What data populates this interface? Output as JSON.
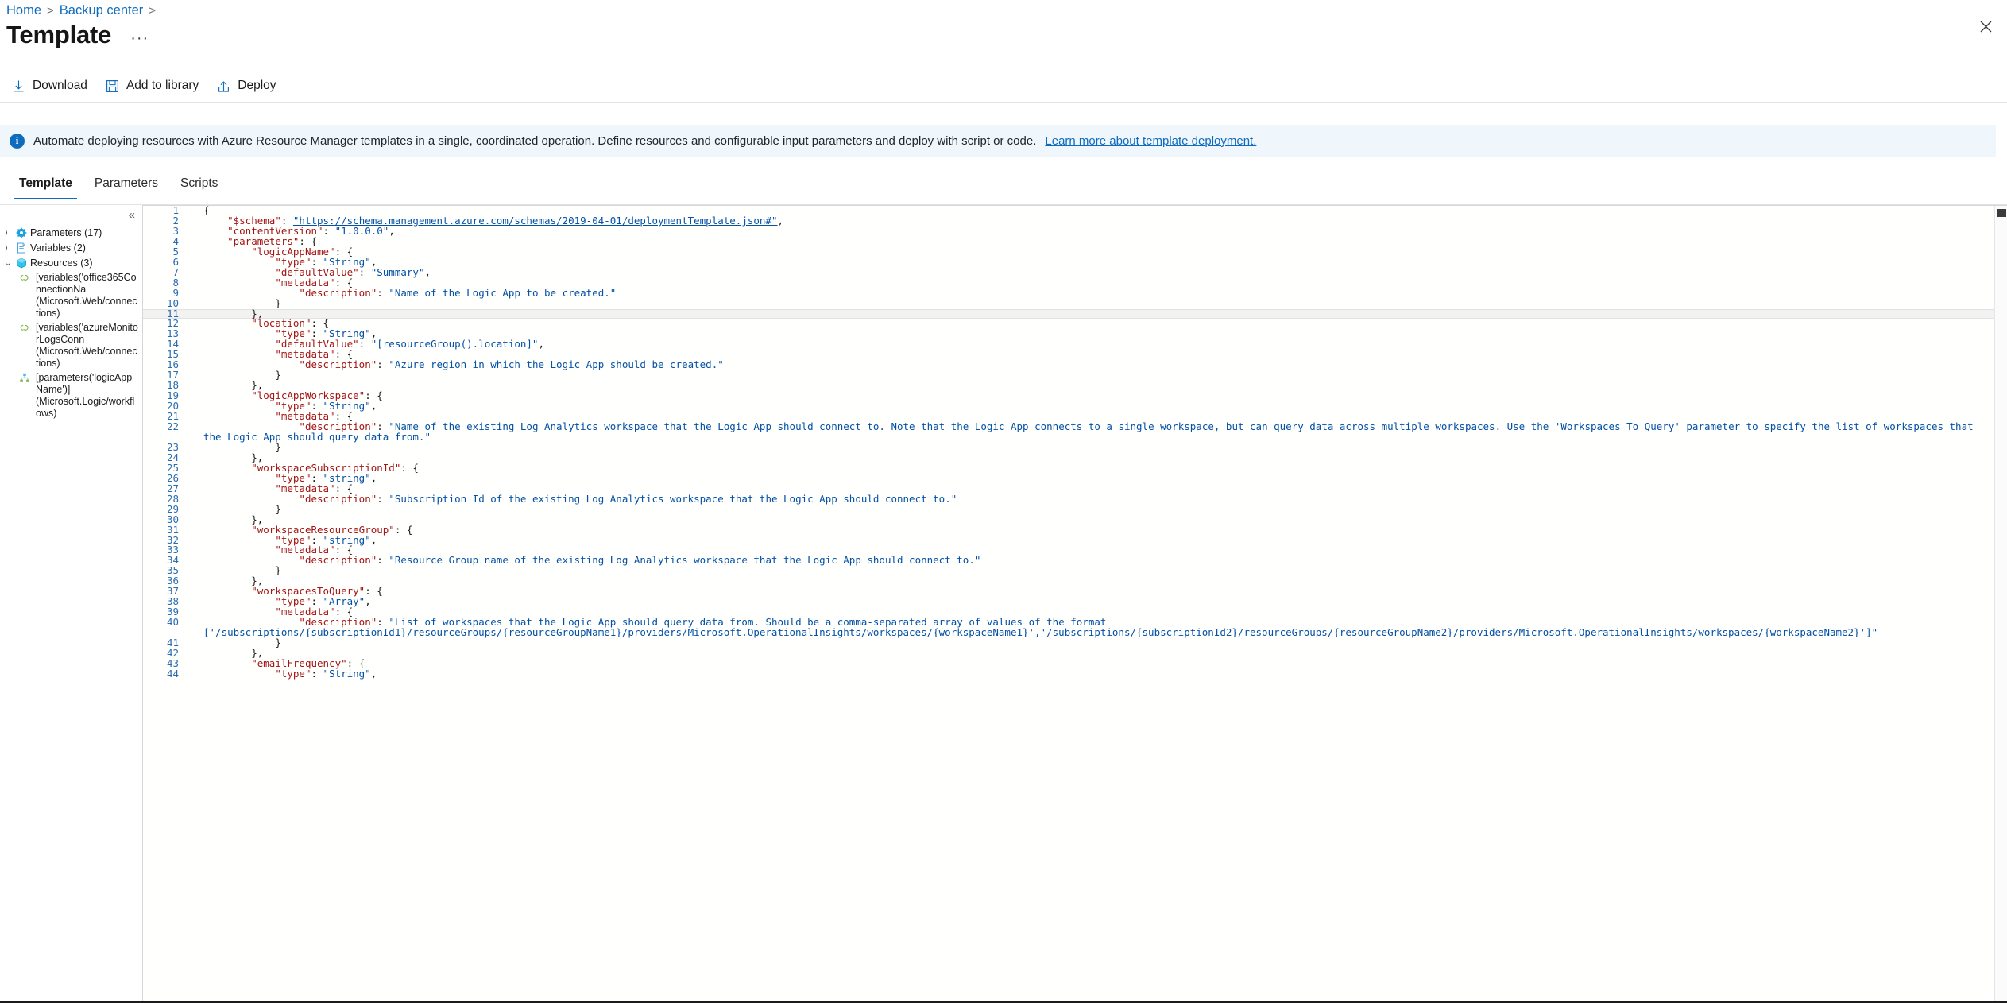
{
  "breadcrumb": {
    "items": [
      "Home",
      "Backup center"
    ],
    "separator": ">"
  },
  "header": {
    "title": "Template",
    "more_label": "···",
    "close_icon": "close-icon"
  },
  "commandbar": {
    "items": [
      {
        "label": "Download",
        "icon": "download-icon"
      },
      {
        "label": "Add to library",
        "icon": "save-floppy-icon"
      },
      {
        "label": "Deploy",
        "icon": "upload-icon"
      }
    ]
  },
  "banner": {
    "icon": "info-icon",
    "text": "Automate deploying resources with Azure Resource Manager templates in a single, coordinated operation. Define resources and configurable input parameters and deploy with script or code. ",
    "link": "Learn more about template deployment.",
    "background": "#eff6fc",
    "accent": "#0f6cbd"
  },
  "tabs": {
    "items": [
      {
        "label": "Template",
        "active": true
      },
      {
        "label": "Parameters",
        "active": false
      },
      {
        "label": "Scripts",
        "active": false
      }
    ]
  },
  "tree": {
    "collapse_icon": "chevron-double-left-icon",
    "nodes": [
      {
        "chevron": "›",
        "icon": "parameters-gear-icon",
        "label": "Parameters (17)",
        "expanded": false
      },
      {
        "chevron": "›",
        "icon": "variables-doc-icon",
        "label": "Variables (2)",
        "expanded": false
      },
      {
        "chevron": "⌄",
        "icon": "resources-cube-icon",
        "label": "Resources (3)",
        "expanded": true
      }
    ],
    "resources": [
      {
        "icon": "connection-link-icon",
        "name": "[variables('office365ConnectionNa",
        "type": "(Microsoft.Web/connections)"
      },
      {
        "icon": "connection-link-icon",
        "name": "[variables('azureMonitorLogsConn",
        "type": "(Microsoft.Web/connections)"
      },
      {
        "icon": "logic-app-icon",
        "name": "[parameters('logicAppName')]",
        "type": "(Microsoft.Logic/workflows)"
      }
    ]
  },
  "editor": {
    "language": "json",
    "current_line": 11,
    "first_line": 1,
    "last_line": 44,
    "colors": {
      "key": "#a31515",
      "string": "#0451a5",
      "punctuation": "#1b1b1b",
      "line_number": "#2b6cb0"
    },
    "lines": [
      {
        "n": 1,
        "tokens": [
          {
            "t": "pun",
            "v": "{"
          }
        ]
      },
      {
        "n": 2,
        "tokens": [
          {
            "t": "pun",
            "v": "    "
          },
          {
            "t": "key",
            "v": "\"$schema\""
          },
          {
            "t": "pun",
            "v": ": "
          },
          {
            "t": "lnk",
            "v": "\"https://schema.management.azure.com/schemas/2019-04-01/deploymentTemplate.json#\""
          },
          {
            "t": "pun",
            "v": ","
          }
        ]
      },
      {
        "n": 3,
        "tokens": [
          {
            "t": "pun",
            "v": "    "
          },
          {
            "t": "key",
            "v": "\"contentVersion\""
          },
          {
            "t": "pun",
            "v": ": "
          },
          {
            "t": "str",
            "v": "\"1.0.0.0\""
          },
          {
            "t": "pun",
            "v": ","
          }
        ]
      },
      {
        "n": 4,
        "tokens": [
          {
            "t": "pun",
            "v": "    "
          },
          {
            "t": "key",
            "v": "\"parameters\""
          },
          {
            "t": "pun",
            "v": ": {"
          }
        ]
      },
      {
        "n": 5,
        "tokens": [
          {
            "t": "pun",
            "v": "        "
          },
          {
            "t": "key",
            "v": "\"logicAppName\""
          },
          {
            "t": "pun",
            "v": ": {"
          }
        ]
      },
      {
        "n": 6,
        "tokens": [
          {
            "t": "pun",
            "v": "            "
          },
          {
            "t": "key",
            "v": "\"type\""
          },
          {
            "t": "pun",
            "v": ": "
          },
          {
            "t": "str",
            "v": "\"String\""
          },
          {
            "t": "pun",
            "v": ","
          }
        ]
      },
      {
        "n": 7,
        "tokens": [
          {
            "t": "pun",
            "v": "            "
          },
          {
            "t": "key",
            "v": "\"defaultValue\""
          },
          {
            "t": "pun",
            "v": ": "
          },
          {
            "t": "str",
            "v": "\"Summary\""
          },
          {
            "t": "pun",
            "v": ","
          }
        ]
      },
      {
        "n": 8,
        "tokens": [
          {
            "t": "pun",
            "v": "            "
          },
          {
            "t": "key",
            "v": "\"metadata\""
          },
          {
            "t": "pun",
            "v": ": {"
          }
        ]
      },
      {
        "n": 9,
        "tokens": [
          {
            "t": "pun",
            "v": "                "
          },
          {
            "t": "key",
            "v": "\"description\""
          },
          {
            "t": "pun",
            "v": ": "
          },
          {
            "t": "str",
            "v": "\"Name of the Logic App to be created.\""
          }
        ]
      },
      {
        "n": 10,
        "tokens": [
          {
            "t": "pun",
            "v": "            }"
          }
        ]
      },
      {
        "n": 11,
        "tokens": [
          {
            "t": "pun",
            "v": "        },"
          }
        ]
      },
      {
        "n": 12,
        "tokens": [
          {
            "t": "pun",
            "v": "        "
          },
          {
            "t": "key",
            "v": "\"location\""
          },
          {
            "t": "pun",
            "v": ": {"
          }
        ]
      },
      {
        "n": 13,
        "tokens": [
          {
            "t": "pun",
            "v": "            "
          },
          {
            "t": "key",
            "v": "\"type\""
          },
          {
            "t": "pun",
            "v": ": "
          },
          {
            "t": "str",
            "v": "\"String\""
          },
          {
            "t": "pun",
            "v": ","
          }
        ]
      },
      {
        "n": 14,
        "tokens": [
          {
            "t": "pun",
            "v": "            "
          },
          {
            "t": "key",
            "v": "\"defaultValue\""
          },
          {
            "t": "pun",
            "v": ": "
          },
          {
            "t": "str",
            "v": "\"[resourceGroup().location]\""
          },
          {
            "t": "pun",
            "v": ","
          }
        ]
      },
      {
        "n": 15,
        "tokens": [
          {
            "t": "pun",
            "v": "            "
          },
          {
            "t": "key",
            "v": "\"metadata\""
          },
          {
            "t": "pun",
            "v": ": {"
          }
        ]
      },
      {
        "n": 16,
        "tokens": [
          {
            "t": "pun",
            "v": "                "
          },
          {
            "t": "key",
            "v": "\"description\""
          },
          {
            "t": "pun",
            "v": ": "
          },
          {
            "t": "str",
            "v": "\"Azure region in which the Logic App should be created.\""
          }
        ]
      },
      {
        "n": 17,
        "tokens": [
          {
            "t": "pun",
            "v": "            }"
          }
        ]
      },
      {
        "n": 18,
        "tokens": [
          {
            "t": "pun",
            "v": "        },"
          }
        ]
      },
      {
        "n": 19,
        "tokens": [
          {
            "t": "pun",
            "v": "        "
          },
          {
            "t": "key",
            "v": "\"logicAppWorkspace\""
          },
          {
            "t": "pun",
            "v": ": {"
          }
        ]
      },
      {
        "n": 20,
        "tokens": [
          {
            "t": "pun",
            "v": "            "
          },
          {
            "t": "key",
            "v": "\"type\""
          },
          {
            "t": "pun",
            "v": ": "
          },
          {
            "t": "str",
            "v": "\"String\""
          },
          {
            "t": "pun",
            "v": ","
          }
        ]
      },
      {
        "n": 21,
        "tokens": [
          {
            "t": "pun",
            "v": "            "
          },
          {
            "t": "key",
            "v": "\"metadata\""
          },
          {
            "t": "pun",
            "v": ": {"
          }
        ]
      },
      {
        "n": 22,
        "tokens": [
          {
            "t": "pun",
            "v": "                "
          },
          {
            "t": "key",
            "v": "\"description\""
          },
          {
            "t": "pun",
            "v": ": "
          },
          {
            "t": "str",
            "v": "\"Name of the existing Log Analytics workspace that the Logic App should connect to. Note that the Logic App connects to a single workspace, but can query data across multiple workspaces. Use the 'Workspaces To Query' parameter to specify the list of workspaces that the Logic App should query data from.\""
          }
        ]
      },
      {
        "n": 23,
        "tokens": [
          {
            "t": "pun",
            "v": "            }"
          }
        ]
      },
      {
        "n": 24,
        "tokens": [
          {
            "t": "pun",
            "v": "        },"
          }
        ]
      },
      {
        "n": 25,
        "tokens": [
          {
            "t": "pun",
            "v": "        "
          },
          {
            "t": "key",
            "v": "\"workspaceSubscriptionId\""
          },
          {
            "t": "pun",
            "v": ": {"
          }
        ]
      },
      {
        "n": 26,
        "tokens": [
          {
            "t": "pun",
            "v": "            "
          },
          {
            "t": "key",
            "v": "\"type\""
          },
          {
            "t": "pun",
            "v": ": "
          },
          {
            "t": "str",
            "v": "\"string\""
          },
          {
            "t": "pun",
            "v": ","
          }
        ]
      },
      {
        "n": 27,
        "tokens": [
          {
            "t": "pun",
            "v": "            "
          },
          {
            "t": "key",
            "v": "\"metadata\""
          },
          {
            "t": "pun",
            "v": ": {"
          }
        ]
      },
      {
        "n": 28,
        "tokens": [
          {
            "t": "pun",
            "v": "                "
          },
          {
            "t": "key",
            "v": "\"description\""
          },
          {
            "t": "pun",
            "v": ": "
          },
          {
            "t": "str",
            "v": "\"Subscription Id of the existing Log Analytics workspace that the Logic App should connect to.\""
          }
        ]
      },
      {
        "n": 29,
        "tokens": [
          {
            "t": "pun",
            "v": "            }"
          }
        ]
      },
      {
        "n": 30,
        "tokens": [
          {
            "t": "pun",
            "v": "        },"
          }
        ]
      },
      {
        "n": 31,
        "tokens": [
          {
            "t": "pun",
            "v": "        "
          },
          {
            "t": "key",
            "v": "\"workspaceResourceGroup\""
          },
          {
            "t": "pun",
            "v": ": {"
          }
        ]
      },
      {
        "n": 32,
        "tokens": [
          {
            "t": "pun",
            "v": "            "
          },
          {
            "t": "key",
            "v": "\"type\""
          },
          {
            "t": "pun",
            "v": ": "
          },
          {
            "t": "str",
            "v": "\"string\""
          },
          {
            "t": "pun",
            "v": ","
          }
        ]
      },
      {
        "n": 33,
        "tokens": [
          {
            "t": "pun",
            "v": "            "
          },
          {
            "t": "key",
            "v": "\"metadata\""
          },
          {
            "t": "pun",
            "v": ": {"
          }
        ]
      },
      {
        "n": 34,
        "tokens": [
          {
            "t": "pun",
            "v": "                "
          },
          {
            "t": "key",
            "v": "\"description\""
          },
          {
            "t": "pun",
            "v": ": "
          },
          {
            "t": "str",
            "v": "\"Resource Group name of the existing Log Analytics workspace that the Logic App should connect to.\""
          }
        ]
      },
      {
        "n": 35,
        "tokens": [
          {
            "t": "pun",
            "v": "            }"
          }
        ]
      },
      {
        "n": 36,
        "tokens": [
          {
            "t": "pun",
            "v": "        },"
          }
        ]
      },
      {
        "n": 37,
        "tokens": [
          {
            "t": "pun",
            "v": "        "
          },
          {
            "t": "key",
            "v": "\"workspacesToQuery\""
          },
          {
            "t": "pun",
            "v": ": {"
          }
        ]
      },
      {
        "n": 38,
        "tokens": [
          {
            "t": "pun",
            "v": "            "
          },
          {
            "t": "key",
            "v": "\"type\""
          },
          {
            "t": "pun",
            "v": ": "
          },
          {
            "t": "str",
            "v": "\"Array\""
          },
          {
            "t": "pun",
            "v": ","
          }
        ]
      },
      {
        "n": 39,
        "tokens": [
          {
            "t": "pun",
            "v": "            "
          },
          {
            "t": "key",
            "v": "\"metadata\""
          },
          {
            "t": "pun",
            "v": ": {"
          }
        ]
      },
      {
        "n": 40,
        "tokens": [
          {
            "t": "pun",
            "v": "                "
          },
          {
            "t": "key",
            "v": "\"description\""
          },
          {
            "t": "pun",
            "v": ": "
          },
          {
            "t": "str",
            "v": "\"List of workspaces that the Logic App should query data from. Should be a comma-separated array of values of the format ['/subscriptions/{subscriptionId1}/resourceGroups/{resourceGroupName1}/providers/Microsoft.OperationalInsights/workspaces/{workspaceName1}','/subscriptions/{subscriptionId2}/resourceGroups/{resourceGroupName2}/providers/Microsoft.OperationalInsights/workspaces/{workspaceName2}']\""
          }
        ]
      },
      {
        "n": 41,
        "tokens": [
          {
            "t": "pun",
            "v": "            }"
          }
        ]
      },
      {
        "n": 42,
        "tokens": [
          {
            "t": "pun",
            "v": "        },"
          }
        ]
      },
      {
        "n": 43,
        "tokens": [
          {
            "t": "pun",
            "v": "        "
          },
          {
            "t": "key",
            "v": "\"emailFrequency\""
          },
          {
            "t": "pun",
            "v": ": {"
          }
        ]
      },
      {
        "n": 44,
        "tokens": [
          {
            "t": "pun",
            "v": "            "
          },
          {
            "t": "key",
            "v": "\"type\""
          },
          {
            "t": "pun",
            "v": ": "
          },
          {
            "t": "str",
            "v": "\"String\""
          },
          {
            "t": "pun",
            "v": ","
          }
        ]
      }
    ]
  }
}
